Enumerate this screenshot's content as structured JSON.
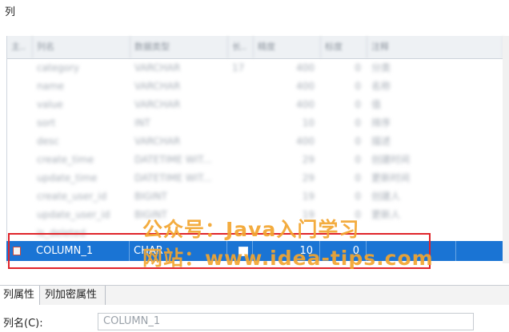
{
  "window": {
    "title_fragment": "列"
  },
  "grid": {
    "headers": [
      "主..",
      "列名",
      "数据类型",
      "长..",
      "精度",
      "标度",
      "注释"
    ],
    "rows": [
      {
        "col1": "",
        "name": "category",
        "type": "VARCHAR",
        "len": "17",
        "prec": "400",
        "scale": "0",
        "comment": "分类"
      },
      {
        "col1": "",
        "name": "name",
        "type": "VARCHAR",
        "len": "",
        "prec": "400",
        "scale": "0",
        "comment": "名称"
      },
      {
        "col1": "",
        "name": "value",
        "type": "VARCHAR",
        "len": "",
        "prec": "400",
        "scale": "0",
        "comment": "值"
      },
      {
        "col1": "",
        "name": "sort",
        "type": "INT",
        "len": "",
        "prec": "10",
        "scale": "0",
        "comment": "排序"
      },
      {
        "col1": "",
        "name": "desc",
        "type": "VARCHAR",
        "len": "",
        "prec": "400",
        "scale": "0",
        "comment": "描述"
      },
      {
        "col1": "",
        "name": "create_time",
        "type": "DATETIME WIT...",
        "len": "",
        "prec": "29",
        "scale": "0",
        "comment": "创建时间"
      },
      {
        "col1": "",
        "name": "update_time",
        "type": "DATETIME WIT...",
        "len": "",
        "prec": "29",
        "scale": "0",
        "comment": "更新时间"
      },
      {
        "col1": "",
        "name": "create_user_id",
        "type": "BIGINT",
        "len": "",
        "prec": "19",
        "scale": "0",
        "comment": "创建人"
      },
      {
        "col1": "",
        "name": "update_user_id",
        "type": "BIGINT",
        "len": "",
        "prec": "19",
        "scale": "0",
        "comment": "更新人"
      },
      {
        "col1": "",
        "name": "is_deleted",
        "type": "",
        "len": "",
        "prec": "",
        "scale": "",
        "comment": ""
      }
    ],
    "selected_row": {
      "name": "COLUMN_1",
      "type": "CHAR",
      "precision": "10",
      "scale": "0"
    }
  },
  "watermark": {
    "line1": "公众号：Java入门学习",
    "line2": "网站：www.idea-tips.com"
  },
  "tabs": [
    {
      "label": "列属性",
      "active": true
    },
    {
      "label": "列加密属性",
      "active": false
    }
  ],
  "property": {
    "label": "列名(C):",
    "value": "COLUMN_1"
  },
  "colors": {
    "selection": "#1a74d4",
    "highlight_box": "#e0242a",
    "watermark": "#f3a52f"
  }
}
